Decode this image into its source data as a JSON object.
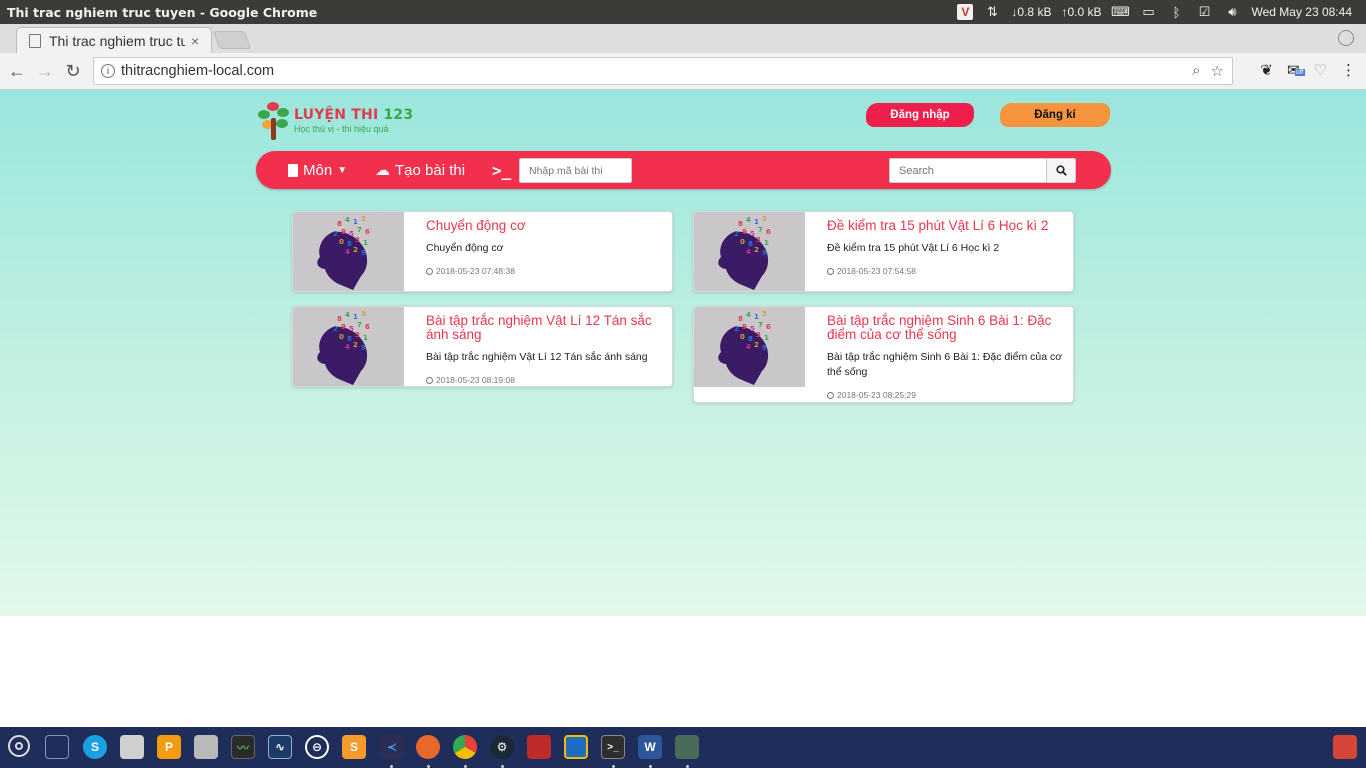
{
  "os": {
    "window_title": "Thi trac nghiem truc tuyen - Google Chrome",
    "net_down": "↓0.8 kB",
    "net_up": "↑0.0 kB",
    "clock": "Wed May 23 08:44"
  },
  "browser": {
    "tab_title": "Thi trac nghiem truc tuyen",
    "tab_close": "×",
    "url": "thitracnghiem-local.com",
    "ext_badge": "off"
  },
  "site": {
    "logo_main": "LUYỆN THI",
    "logo_num": "123",
    "logo_sub": "Học thú vị - thi hiệu quả",
    "login_label": "Đăng nhập",
    "register_label": "Đăng kí",
    "nav": {
      "subjects_label": "Môn",
      "create_label": "Tạo bài thi",
      "terminal_label": ">_",
      "code_placeholder": "Nhập mã bài thi",
      "search_placeholder": "Search"
    },
    "cards": [
      {
        "title": "Chuyển động cơ",
        "desc": "Chuyển động cơ",
        "date": "2018-05-23 07:48:38"
      },
      {
        "title": "Đề kiểm tra 15 phút Vật Lí 6 Học kì 2",
        "desc": "Đề kiểm tra 15 phút Vật Lí 6 Học kì 2",
        "date": "2018-05-23 07:54:58"
      },
      {
        "title": "Bài tập trắc nghiệm Vật Lí 12 Tán sắc ánh sáng",
        "desc": "Bài tập trắc nghiệm Vật Lí 12 Tán sắc ánh sáng",
        "date": "2018-05-23 08:19:08"
      },
      {
        "title": "Bài tập trắc nghiệm Sinh 6 Bài 1: Đặc điểm của cơ thể sống",
        "desc": "Bài tập trắc nghiệm Sinh 6 Bài 1: Đặc điểm của cơ thể sống",
        "date": "2018-05-23 08:25:29"
      }
    ]
  },
  "colors": {
    "accent": "#f2304e",
    "title_red": "#e8364e",
    "login_bg": "#ee1f4c",
    "register_bg": "#f7953e",
    "page_bg_top": "#9ae6de",
    "taskbar": "#1f2d5a"
  },
  "taskbar": {
    "apps": [
      "ubuntu-launcher-icon",
      "workspace-icon",
      "skype-icon",
      "files-icon",
      "pdf-icon",
      "camera-icon",
      "system-monitor-icon",
      "audio-editor-icon",
      "remote-desktop-icon",
      "sublime-text-icon",
      "vscode-icon",
      "firefox-icon",
      "chrome-icon",
      "steam-icon",
      "filezilla-icon",
      "virtualbox-icon",
      "terminal-icon",
      "word-icon",
      "android-studio-icon",
      "trash-icon"
    ]
  }
}
